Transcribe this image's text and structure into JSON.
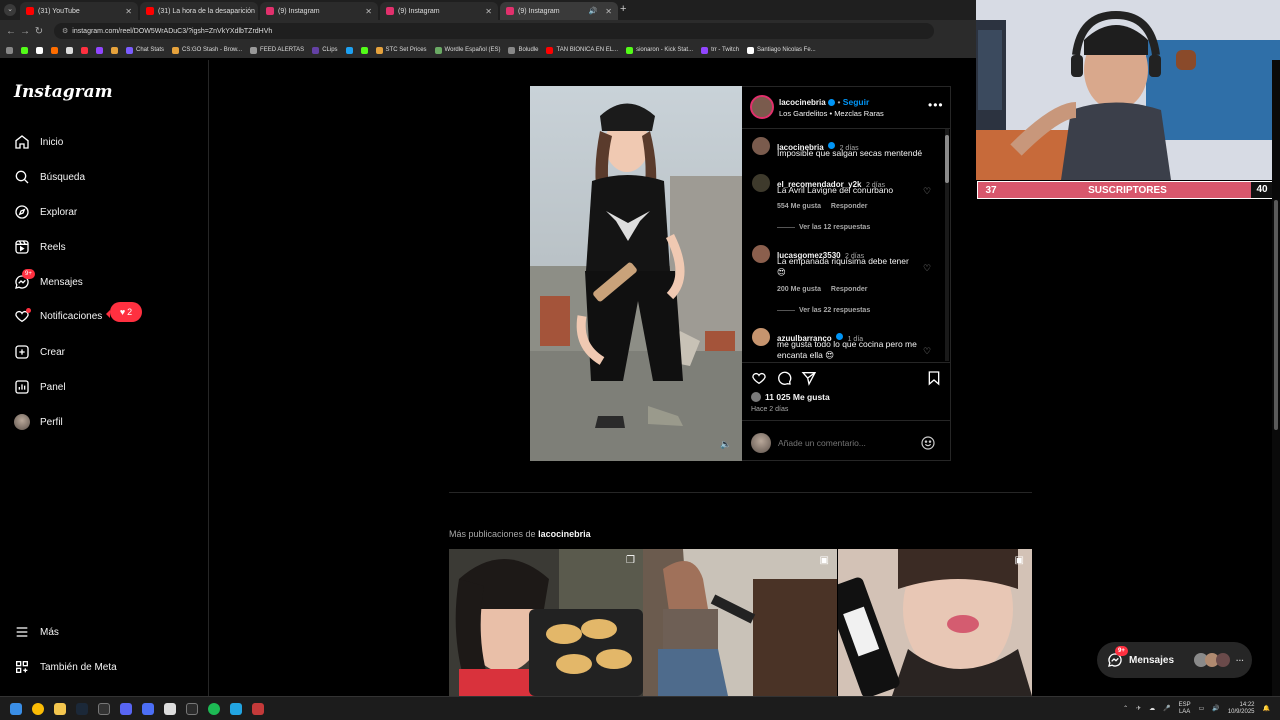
{
  "browser": {
    "tabs": [
      {
        "title": "(31) YouTube",
        "color": "#ff0000"
      },
      {
        "title": "(31) La hora de la desaparición",
        "color": "#ff0000"
      },
      {
        "title": "(9) Instagram",
        "color": "#e1306c"
      },
      {
        "title": "(9) Instagram",
        "color": "#e1306c"
      },
      {
        "title": "(9) Instagram",
        "color": "#e1306c",
        "active": true
      }
    ],
    "url": "instagram.com/reel/DOW5WrADuC3/?igsh=ZnVkYXdlbTZrdHVh",
    "bookmarks": [
      {
        "label": "Chat Stats",
        "color": "#7b5cff"
      },
      {
        "label": "CS:GO Stash - Brow...",
        "color": "#e6a23c"
      },
      {
        "label": "FEED ALERTAS",
        "color": "#999999"
      },
      {
        "label": "CLips",
        "color": "#6441a5"
      },
      {
        "label": "STC Set Prices",
        "color": "#e6a23c"
      },
      {
        "label": "Wordle Español (ES)",
        "color": "#6aaa64"
      },
      {
        "label": "Boludle",
        "color": "#888888"
      },
      {
        "label": "TAN BIONICA EN EL...",
        "color": "#ff0000"
      },
      {
        "label": "sionaron - Kick Stat...",
        "color": "#53fc18"
      },
      {
        "label": "trr - Twitch",
        "color": "#9146ff"
      },
      {
        "label": "Santiago Nicolas Fe...",
        "color": "#ffffff"
      }
    ]
  },
  "sidebar": {
    "logo": "Instagram",
    "items": [
      {
        "label": "Inicio",
        "icon": "home-icon"
      },
      {
        "label": "Búsqueda",
        "icon": "search-icon"
      },
      {
        "label": "Explorar",
        "icon": "compass-icon"
      },
      {
        "label": "Reels",
        "icon": "reels-icon"
      },
      {
        "label": "Mensajes",
        "icon": "messenger-icon",
        "badge": "9+"
      },
      {
        "label": "Notificaciones",
        "icon": "heart-icon"
      },
      {
        "label": "Crear",
        "icon": "plus-square-icon"
      },
      {
        "label": "Panel",
        "icon": "chart-icon"
      },
      {
        "label": "Perfil",
        "icon": "avatar-icon"
      }
    ],
    "notif_count": "2",
    "bottom": [
      {
        "label": "Más",
        "icon": "menu-icon"
      },
      {
        "label": "También de Meta",
        "icon": "meta-grid-icon"
      }
    ]
  },
  "post": {
    "username": "lacocinebria",
    "follow": "Seguir",
    "subtitle_artist": "Los Gardelitos",
    "subtitle_song": "Mezclas Raras",
    "likes": "11 025 Me gusta",
    "time_ago": "Hace 2 días",
    "add_comment_placeholder": "Añade un comentario...",
    "comments": [
      {
        "user": "lacocinebria",
        "verified": true,
        "time": "2 días",
        "text": "Imposible que salgan secas mentendé",
        "caption": true
      },
      {
        "user": "el_recomendador_y2k",
        "time": "2 días",
        "text": "La Avril Lavigne del conurbano",
        "likes": "554 Me gusta",
        "reply": "Responder",
        "view_replies": "Ver las 12 respuestas"
      },
      {
        "user": "lucasgomez3530",
        "time": "2 días",
        "text": "La empanada riquísima debe tener 😍",
        "likes": "200 Me gusta",
        "reply": "Responder",
        "view_replies": "Ver las 22 respuestas"
      },
      {
        "user": "azuulbarranco",
        "verified": true,
        "time": "1 día",
        "text": "me gusta todo lo que cocina pero me encanta ella 😍"
      }
    ]
  },
  "more": {
    "prefix": "Más publicaciones de",
    "user": "lacocinebria"
  },
  "messages_float": {
    "label": "Mensajes",
    "badge": "9+"
  },
  "stream_overlay": {
    "current": "37",
    "label": "SUSCRIPTORES",
    "goal": "40"
  },
  "taskbar": {
    "lang": "ESP",
    "lang2": "LAA",
    "time": "14:22",
    "date": "10/9/2025"
  }
}
